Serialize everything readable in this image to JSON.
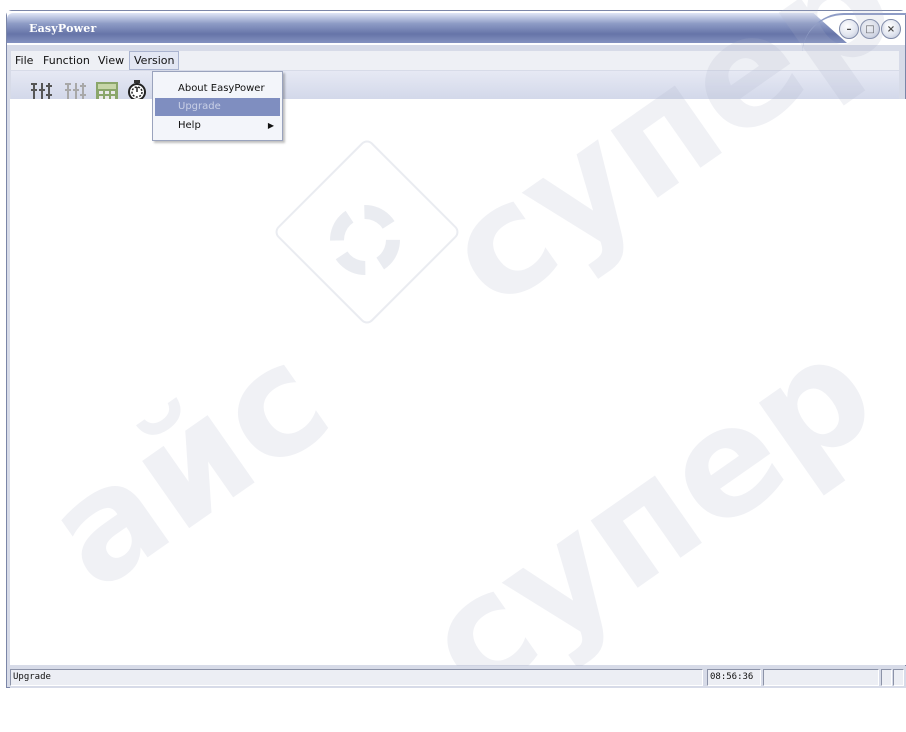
{
  "window": {
    "title": "EasyPower",
    "controls": {
      "minimize": "–",
      "maximize": "□",
      "close": "×"
    }
  },
  "menubar": {
    "items": [
      {
        "label": "File"
      },
      {
        "label": "Function"
      },
      {
        "label": "View"
      },
      {
        "label": "Version"
      }
    ]
  },
  "toolbar": {
    "icons": [
      "connect-icon",
      "disconnect-icon",
      "calculator-icon",
      "timer-icon"
    ]
  },
  "version_menu": {
    "items": [
      {
        "label": "About EasyPower"
      },
      {
        "label": "Upgrade"
      },
      {
        "label": "Help"
      }
    ],
    "submenu_arrow": "▶"
  },
  "statusbar": {
    "message": "Upgrade",
    "time": "08:56:36"
  },
  "watermark": {
    "text": "супер",
    "text2": "айс"
  },
  "colors": {
    "title_gradient_dark": "#6674a8",
    "menu_highlight": "#7f8ec0"
  }
}
